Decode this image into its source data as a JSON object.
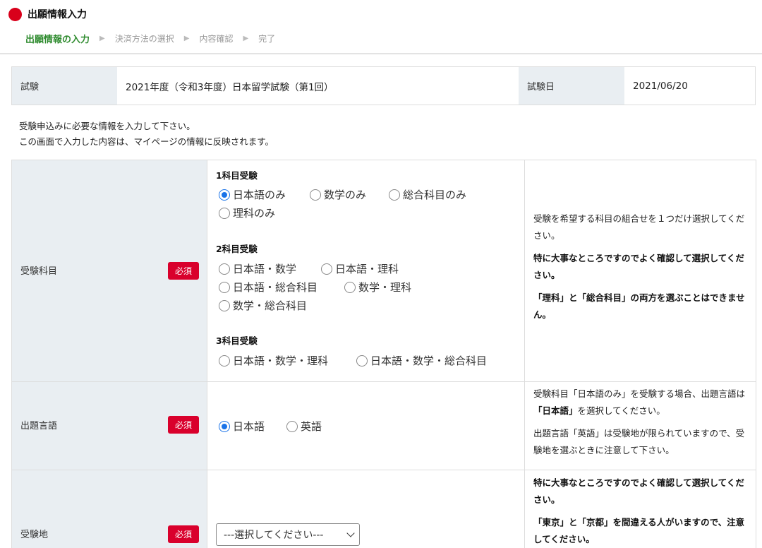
{
  "header": {
    "title": "出願情報入力",
    "steps": [
      "出願情報の入力",
      "決済方法の選択",
      "内容確認",
      "完了"
    ]
  },
  "exam": {
    "exam_label": "試験",
    "exam_value": "2021年度（令和3年度）日本留学試験（第1回）",
    "date_label": "試験日",
    "date_value": "2021/06/20"
  },
  "intro": {
    "line1": "受験申込みに必要な情報を入力して下さい。",
    "line2": "この画面で入力した内容は、マイページの情報に反映されます。"
  },
  "required_label": "必須",
  "subjects": {
    "label": "受験科目",
    "group1_title": "1科目受験",
    "group1_options": [
      "日本語のみ",
      "数学のみ",
      "総合科目のみ",
      "理科のみ"
    ],
    "group2_title": "2科目受験",
    "group2_options": [
      "日本語・数学",
      "日本語・理科",
      "日本語・総合科目",
      "数学・理科",
      "数学・総合科目"
    ],
    "group3_title": "3科目受験",
    "group3_options": [
      "日本語・数学・理科",
      "日本語・数学・総合科目"
    ],
    "selected": "日本語のみ",
    "note1": "受験を希望する科目の組合せを１つだけ選択してください。",
    "note2": "特に大事なところですのでよく確認して選択してください。",
    "note3": "「理科」と「総合科目」の両方を選ぶことはできません。"
  },
  "language": {
    "label": "出題言語",
    "options": [
      "日本語",
      "英語"
    ],
    "selected": "日本語",
    "note1_pre": "受験科目「日本語のみ」を受験する場合、出題言語は",
    "note1_bold": "「日本語」",
    "note1_post": "を選択してください。",
    "note2": "出題言語「英語」は受験地が限られていますので、受験地を選ぶときに注意して下さい。"
  },
  "location": {
    "label": "受験地",
    "select_value": "---選択してください---",
    "note1": "特に大事なところですのでよく確認して選択してください。",
    "note2": "「東京」と「京都」を間違える人がいますので、注意してください。"
  }
}
